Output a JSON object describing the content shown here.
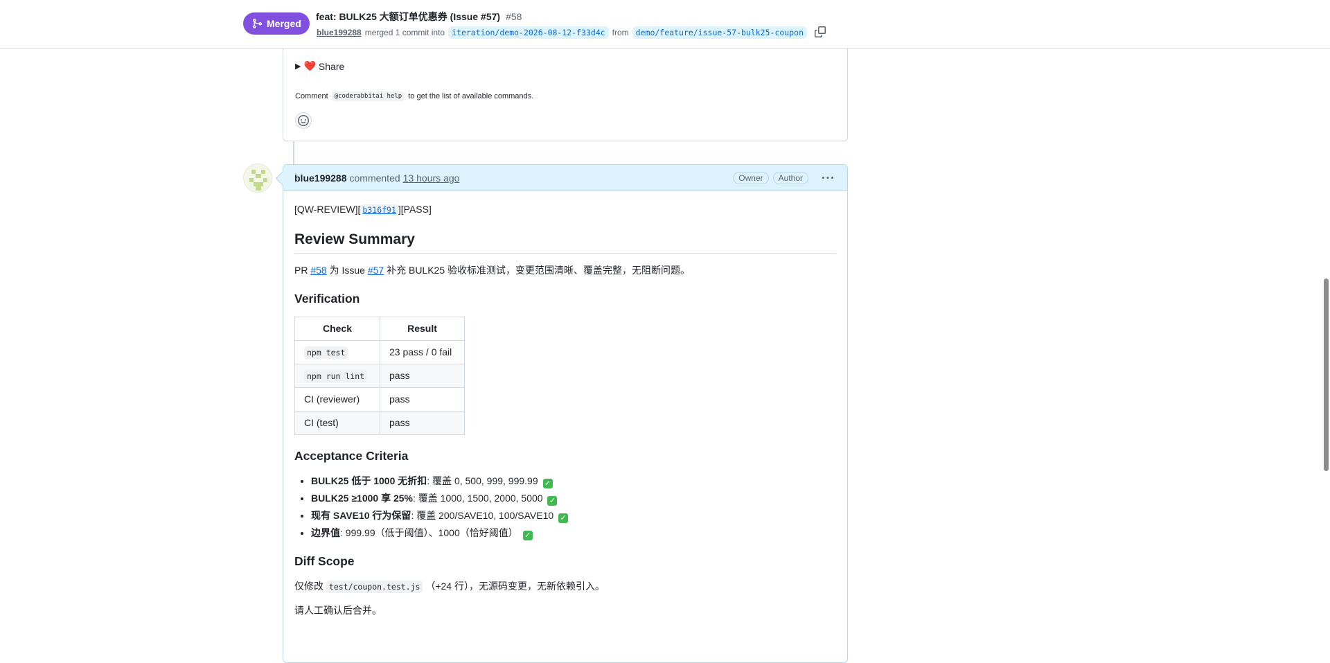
{
  "header": {
    "status_label": "Merged",
    "title": "feat: BULK25 大额订单优惠券 (Issue #57)",
    "number": "#58",
    "author": "blue199288",
    "merged_text": "merged 1 commit into",
    "base_branch": "iteration/demo-2026-08-12-f33d4c",
    "from_text": "from",
    "head_branch": "demo/feature/issue-57-bulk25-coupon"
  },
  "prev_comment": {
    "share_label": "Share",
    "help_prefix": "Comment",
    "help_command": "@coderabbitai help",
    "help_suffix": "to get the list of available commands."
  },
  "comment": {
    "author": "blue199288",
    "verb": "commented",
    "time": "13 hours ago",
    "badges": [
      "Owner",
      "Author"
    ],
    "qw_prefix": "[QW-REVIEW][",
    "qw_commit": "b316f91",
    "qw_suffix": "][PASS]",
    "summary_heading": "Review Summary",
    "summary_pr": "PR",
    "summary_pr_link": "#58",
    "summary_mid": "为 Issue",
    "summary_issue_link": "#57",
    "summary_rest": "补充 BULK25 验收标准测试，变更范围清晰、覆盖完整，无阻断问题。",
    "verification_heading": "Verification",
    "table": {
      "headers": [
        "Check",
        "Result"
      ],
      "rows": [
        {
          "check": "npm test",
          "code": true,
          "result": "23 pass / 0 fail"
        },
        {
          "check": "npm run lint",
          "code": true,
          "result": "pass"
        },
        {
          "check": "CI (reviewer)",
          "code": false,
          "result": "pass"
        },
        {
          "check": "CI (test)",
          "code": false,
          "result": "pass"
        }
      ]
    },
    "acceptance_heading": "Acceptance Criteria",
    "criteria": [
      {
        "bold": "BULK25 低于 1000 无折扣",
        "text": ": 覆盖 0, 500, 999, 999.99"
      },
      {
        "bold": "BULK25 ≥1000 享 25%",
        "text": ": 覆盖 1000, 1500, 2000, 5000"
      },
      {
        "bold": "现有 SAVE10 行为保留",
        "text": ": 覆盖 200/SAVE10, 100/SAVE10"
      },
      {
        "bold": "边界值",
        "text": ": 999.99（低于阈值）、1000（恰好阈值）"
      }
    ],
    "diff_heading": "Diff Scope",
    "diff_prefix": "仅修改",
    "diff_file": "test/coupon.test.js",
    "diff_suffix": "（+24 行），无源码变更，无新依赖引入。",
    "closing": "请人工确认后合并。",
    "check_mark": "✓"
  },
  "colors": {
    "merged": "#8250df",
    "link": "#0969da",
    "comment_header_bg": "#ddf4ff",
    "check_green": "#3fb950"
  }
}
